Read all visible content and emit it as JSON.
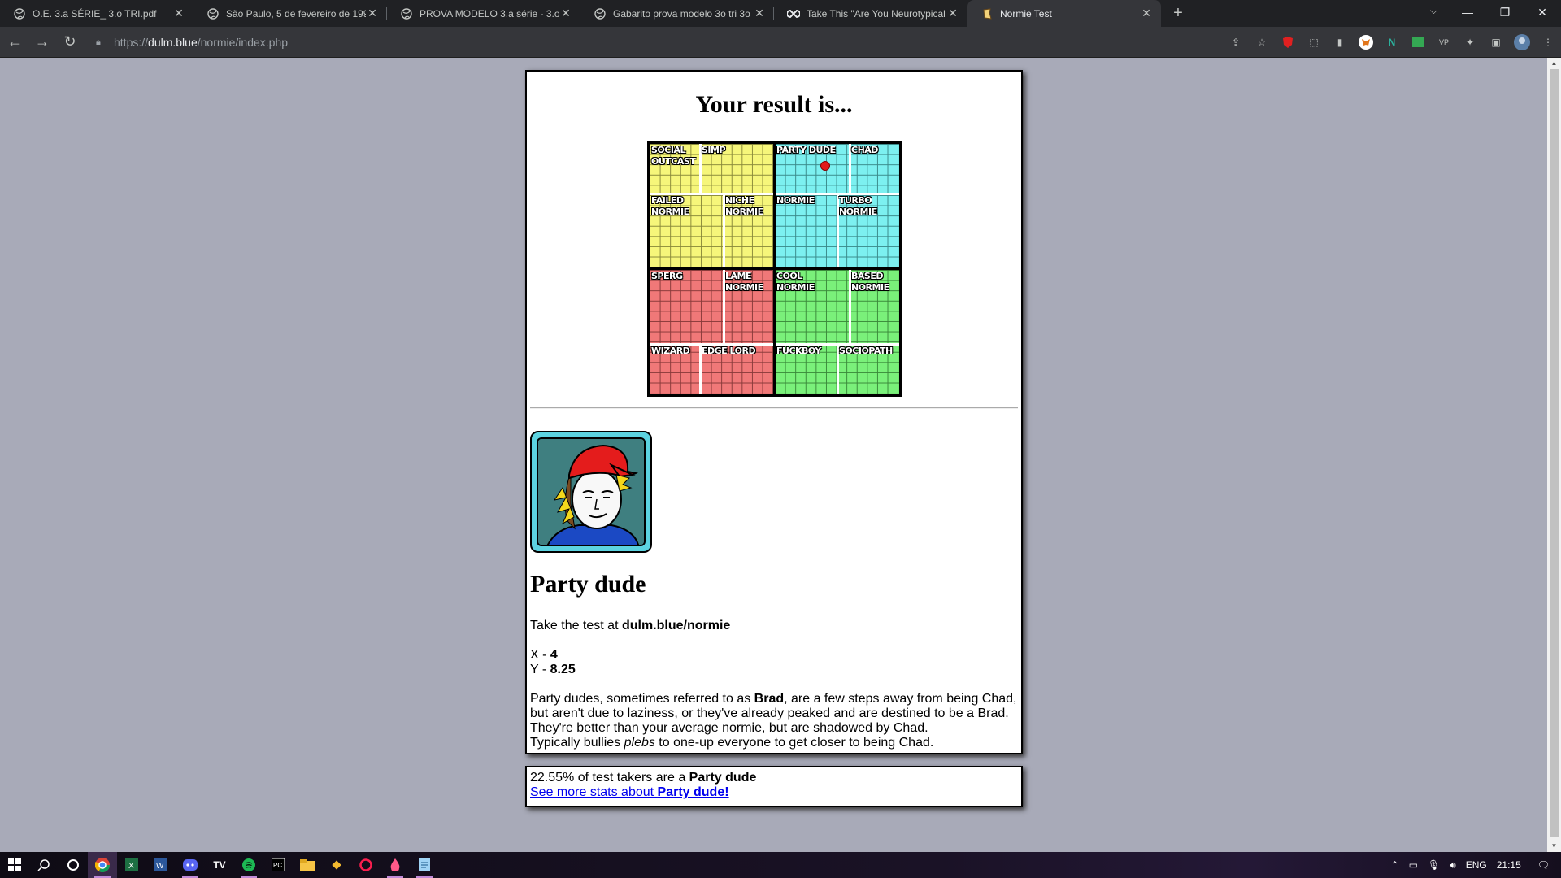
{
  "browser": {
    "tabs": [
      {
        "title": "O.E. 3.a SÉRIE_ 3.o TRI.pdf",
        "icon": "globe-icon",
        "active": false
      },
      {
        "title": "São Paulo, 5 de fevereiro de 199",
        "icon": "globe-icon",
        "active": false
      },
      {
        "title": "PROVA MODELO 3.a série - 3.o t",
        "icon": "globe-icon",
        "active": false
      },
      {
        "title": "Gabarito prova modelo 3o tri 3o",
        "icon": "globe-icon",
        "active": false
      },
      {
        "title": "Take This \"Are You Neurotypical\"",
        "icon": "infinity-icon",
        "active": false
      },
      {
        "title": "Normie Test",
        "icon": "normie-favicon-icon",
        "active": true
      }
    ],
    "url": {
      "scheme": "https://",
      "host": "dulm.blue",
      "path": "/normie/index.php"
    }
  },
  "page": {
    "title": "Your result is...",
    "grid": {
      "labels": {
        "social_outcast": "SOCIAL\nOUTCAST",
        "simp": "SIMP",
        "party_dude": "PARTY DUDE",
        "chad": "CHAD",
        "failed_normie": "FAILED\nNORMIE",
        "niche_normie": "NICHE\nNORMIE",
        "normie": "NORMIE",
        "turbo_normie": "TURBO\nNORMIE",
        "sperg": "SPERG",
        "lame_normie": "LAME\nNORMIE",
        "cool_normie": "COOL\nNORMIE",
        "based_normie": "BASED\nNORMIE",
        "wizard": "WIZARD",
        "edge_lord": "EDGE LORD",
        "fuckboy": "FUCKBOY",
        "sociopath": "SOCIOPATH"
      },
      "marker": {
        "x": 4,
        "y": 8.25
      },
      "x_range": [
        -10,
        10
      ],
      "y_range": [
        -10,
        10
      ],
      "colors": {
        "top_left": "#f6f67a",
        "top_right": "#7cf0f0",
        "bottom_left": "#f07878",
        "bottom_right": "#7af07a",
        "marker": "#e21a1a"
      }
    },
    "result": {
      "name": "Party dude",
      "take_test_prefix": "Take the test at ",
      "take_test_link": "dulm.blue/normie",
      "x_label": "X - ",
      "x_value": "4",
      "y_label": "Y - ",
      "y_value": "8.25",
      "desc_1": "Party dudes, sometimes referred to as ",
      "desc_brad": "Brad",
      "desc_2": ", are a few steps away from being Chad, but aren't due to laziness, or they've already peaked and are destined to be a Brad. They're better than your average normie, but are shadowed by Chad.",
      "desc_3a": "Typically bullies ",
      "desc_plebs": "plebs",
      "desc_3b": " to one-up everyone to get closer to being Chad."
    },
    "stats": {
      "percent_text": "22.55% of test takers are a ",
      "type_name": "Party dude",
      "link_prefix": "See more stats about ",
      "link_name": "Party dude!"
    }
  },
  "taskbar": {
    "language": "ENG",
    "time": "21:15"
  }
}
